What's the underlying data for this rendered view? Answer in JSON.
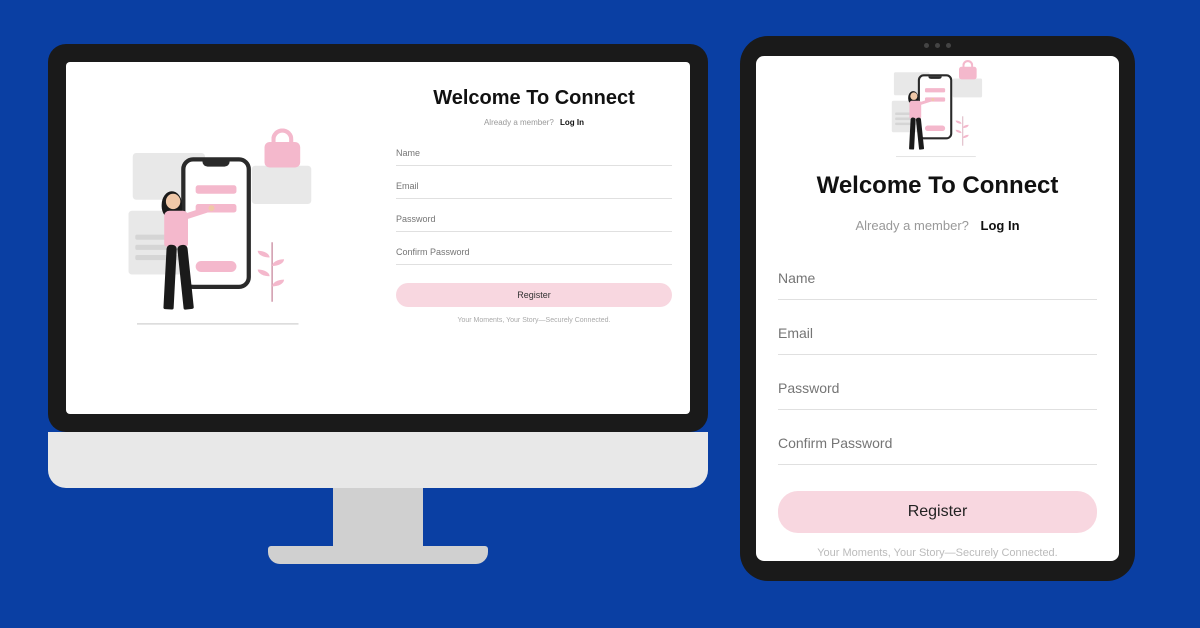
{
  "form": {
    "title": "Welcome To Connect",
    "member_prompt": "Already a member?",
    "login_link": "Log In",
    "fields": {
      "name": "Name",
      "email": "Email",
      "password": "Password",
      "confirm_password": "Confirm Password"
    },
    "register_button": "Register",
    "tagline": "Your Moments, Your Story—Securely Connected."
  },
  "colors": {
    "background": "#0a3fa3",
    "accent": "#f8d7e0",
    "bezel": "#1a1a1a"
  }
}
